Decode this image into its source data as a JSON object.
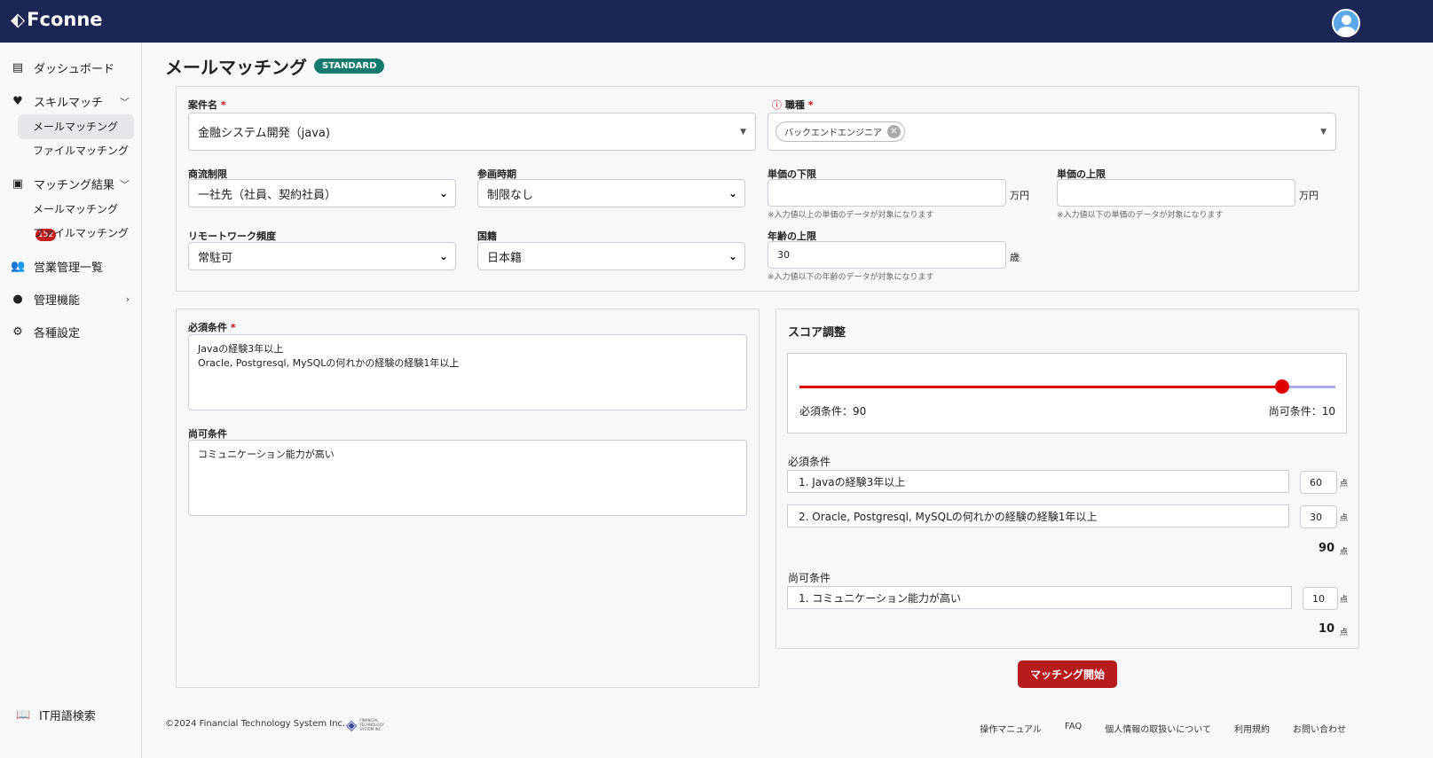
{
  "header": {
    "logo": "Fconne"
  },
  "sidebar": {
    "items": [
      {
        "label": "ダッシュボード",
        "icon": "dashboard-icon"
      },
      {
        "label": "スキルマッチ",
        "icon": "heart-pulse-icon",
        "sub": [
          "メールマッチング",
          "ファイルマッチング"
        ]
      },
      {
        "label": "マッチング結果",
        "icon": "clipboard-icon",
        "sub": [
          "メールマッチング",
          "ファイルマッチング"
        ],
        "badge": "152"
      },
      {
        "label": "営業管理一覧",
        "icon": "team-icon"
      },
      {
        "label": "管理機能",
        "icon": "user-icon"
      },
      {
        "label": "各種設定",
        "icon": "gear-icon"
      }
    ],
    "bottom": "IT用語検索"
  },
  "page": {
    "title": "メールマッチング",
    "plan": "STANDARD"
  },
  "form": {
    "project_label": "案件名",
    "project_value": "金融システム開発（java)",
    "job_label": "職種",
    "job_chip": "バックエンドエンジニア",
    "commerce_label": "商流制限",
    "commerce_value": "一社先（社員、契約社員）",
    "join_label": "参画時期",
    "join_value": "制限なし",
    "price_min_label": "単価の下限",
    "price_min_value": "",
    "price_unit": "万円",
    "price_min_hint": "※入力値以上の単価のデータが対象になります",
    "price_max_label": "単価の上限",
    "price_max_value": "",
    "price_max_hint": "※入力値以下の単価のデータが対象になります",
    "remote_label": "リモートワーク頻度",
    "remote_value": "常駐可",
    "nation_label": "国籍",
    "nation_value": "日本籍",
    "age_label": "年齢の上限",
    "age_value": "30",
    "age_unit": "歳",
    "age_hint": "※入力値以下の年齢のデータが対象になります"
  },
  "conditions": {
    "required_label": "必須条件",
    "required_text": "Javaの経験3年以上\nOracle, Postgresql, MySQLの何れかの経験の経験1年以上",
    "optional_label": "尚可条件",
    "optional_text": "コミュニケーション能力が高い"
  },
  "score": {
    "title": "スコア調整",
    "slider_percent": 90,
    "required_score_label": "必須条件：90",
    "optional_score_label": "尚可条件：10",
    "required_label": "必須条件",
    "required_items": [
      {
        "text": "1. Javaの経験3年以上",
        "points": "60"
      },
      {
        "text": "2. Oracle, Postgresql, MySQLの何れかの経験の経験1年以上",
        "points": "30"
      }
    ],
    "required_total": "90",
    "optional_label": "尚可条件",
    "optional_items": [
      {
        "text": "1. コミュニケーション能力が高い",
        "points": "10"
      }
    ],
    "optional_total": "10",
    "unit": "点",
    "colors": {
      "track": "#e00000",
      "rest": "#a9a9f0"
    }
  },
  "start_button": "マッチング開始",
  "footer": {
    "copyright": "©2024 Financial Technology System Inc.",
    "logo_text": "FINANCIAL TECHNOLOGY SYSTEM INC.",
    "links": [
      "操作マニュアル",
      "FAQ",
      "個人情報の取扱いについて",
      "利用規約",
      "お問い合わせ"
    ]
  }
}
